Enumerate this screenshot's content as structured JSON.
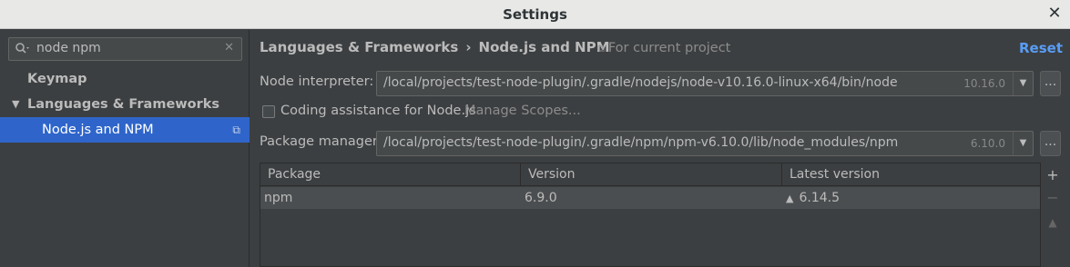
{
  "window": {
    "title": "Settings"
  },
  "search": {
    "value": "node npm"
  },
  "tree": {
    "keymap": "Keymap",
    "languages": "Languages & Frameworks",
    "node": "Node.js and NPM"
  },
  "header": {
    "crumb1": "Languages & Frameworks",
    "sep": "›",
    "crumb2": "Node.js and NPM",
    "scope": "For current project",
    "reset": "Reset"
  },
  "node_interpreter": {
    "label": "Node interpreter:",
    "path": "/local/projects/test-node-plugin/.gradle/nodejs/node-v10.16.0-linux-x64/bin/node",
    "version": "10.16.0"
  },
  "coding_assistance": {
    "label": "Coding assistance for Node.js",
    "checked": false,
    "manage_scopes": "Manage Scopes..."
  },
  "package_manager": {
    "label": "Package manager:",
    "path": "/local/projects/test-node-plugin/.gradle/npm/npm-v6.10.0/lib/node_modules/npm",
    "version": "6.10.0"
  },
  "packages_table": {
    "columns": [
      "Package",
      "Version",
      "Latest version"
    ],
    "rows": [
      {
        "package": "npm",
        "version": "6.9.0",
        "latest": "6.14.5"
      }
    ]
  },
  "icons": {
    "search": "search-icon",
    "clear": "clear-icon",
    "close": "close-icon",
    "browse": "ellipsis-button",
    "add": "plus-icon",
    "remove": "minus-icon",
    "upgrade": "upgrade-arrow-icon"
  },
  "buttons": {
    "browse": "..."
  },
  "colors": {
    "selection": "#2f65ca",
    "link": "#589df6",
    "background": "#3c3f41"
  }
}
